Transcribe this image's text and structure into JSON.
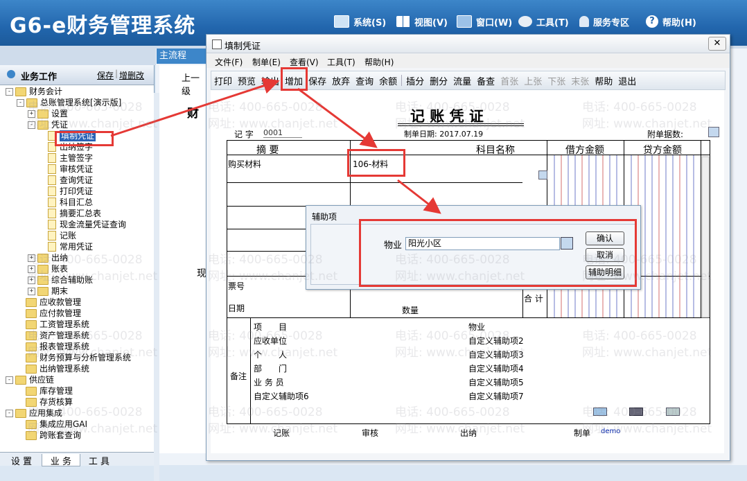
{
  "app": {
    "title": "G6-e财务管理系统"
  },
  "top_menu": [
    {
      "label": "系统(S)",
      "icon": "monitor-icon"
    },
    {
      "label": "视图(V)",
      "icon": "grid-icon"
    },
    {
      "label": "窗口(W)",
      "icon": "window-icon"
    },
    {
      "label": "工具(T)",
      "icon": "gear-icon"
    },
    {
      "label": "服务专区",
      "icon": "user-icon"
    },
    {
      "label": "帮助(H)",
      "icon": "help-icon"
    }
  ],
  "left_panel": {
    "title": "业务工作",
    "save": "保存",
    "add_delete": "增删改",
    "tree": [
      {
        "label": "财务会计",
        "level": 0,
        "type": "folder",
        "exp": "-"
      },
      {
        "label": "总账管理系统[演示版]",
        "level": 1,
        "type": "folder",
        "exp": "-"
      },
      {
        "label": "设置",
        "level": 2,
        "type": "folder",
        "exp": "+"
      },
      {
        "label": "凭证",
        "level": 2,
        "type": "folder",
        "exp": "-"
      },
      {
        "label": "填制凭证",
        "level": 3,
        "type": "doc",
        "selected": true
      },
      {
        "label": "出纳签字",
        "level": 3,
        "type": "doc"
      },
      {
        "label": "主管签字",
        "level": 3,
        "type": "doc"
      },
      {
        "label": "审核凭证",
        "level": 3,
        "type": "doc"
      },
      {
        "label": "查询凭证",
        "level": 3,
        "type": "doc"
      },
      {
        "label": "打印凭证",
        "level": 3,
        "type": "doc"
      },
      {
        "label": "科目汇总",
        "level": 3,
        "type": "doc"
      },
      {
        "label": "摘要汇总表",
        "level": 3,
        "type": "doc"
      },
      {
        "label": "现金流量凭证查询",
        "level": 3,
        "type": "doc"
      },
      {
        "label": "记账",
        "level": 3,
        "type": "doc"
      },
      {
        "label": "常用凭证",
        "level": 3,
        "type": "doc"
      },
      {
        "label": "出纳",
        "level": 2,
        "type": "folder",
        "exp": "+"
      },
      {
        "label": "账表",
        "level": 2,
        "type": "folder",
        "exp": "+"
      },
      {
        "label": "综合辅助账",
        "level": 2,
        "type": "folder",
        "exp": "+"
      },
      {
        "label": "期末",
        "level": 2,
        "type": "folder",
        "exp": "+"
      },
      {
        "label": "应收款管理",
        "level": 1,
        "type": "folder"
      },
      {
        "label": "应付款管理",
        "level": 1,
        "type": "folder"
      },
      {
        "label": "工资管理系统",
        "level": 1,
        "type": "folder"
      },
      {
        "label": "资产管理系统",
        "level": 1,
        "type": "folder"
      },
      {
        "label": "报表管理系统",
        "level": 1,
        "type": "folder"
      },
      {
        "label": "财务预算与分析管理系统",
        "level": 1,
        "type": "folder"
      },
      {
        "label": "出纳管理系统",
        "level": 1,
        "type": "folder"
      },
      {
        "label": "供应链",
        "level": 0,
        "type": "folder",
        "exp": "-"
      },
      {
        "label": "库存管理",
        "level": 1,
        "type": "folder"
      },
      {
        "label": "存货核算",
        "level": 1,
        "type": "folder"
      },
      {
        "label": "应用集成",
        "level": 0,
        "type": "folder",
        "exp": "-"
      },
      {
        "label": "集成应用GAI",
        "level": 1,
        "type": "folder"
      },
      {
        "label": "跨账套查询",
        "level": 1,
        "type": "folder"
      }
    ],
    "bottom_tabs": [
      "设 置",
      "业 务",
      "工 具"
    ]
  },
  "main": {
    "tab": "主流程",
    "back": "上一级",
    "bg_text1": "财",
    "bg_text2": "现"
  },
  "dialog": {
    "title": "填制凭证",
    "menu": [
      "文件(F)",
      "制单(E)",
      "查看(V)",
      "工具(T)",
      "帮助(H)"
    ],
    "toolbar": [
      {
        "label": "打印",
        "enabled": true
      },
      {
        "label": "预览",
        "enabled": true
      },
      {
        "label": "输出",
        "enabled": true
      },
      {
        "label": "增加",
        "enabled": true
      },
      {
        "label": "保存",
        "enabled": true
      },
      {
        "label": "放弃",
        "enabled": true
      },
      {
        "label": "查询",
        "enabled": true
      },
      {
        "label": "余额",
        "enabled": true
      },
      {
        "label": "|",
        "enabled": true
      },
      {
        "label": "插分",
        "enabled": true
      },
      {
        "label": "删分",
        "enabled": true
      },
      {
        "label": "流量",
        "enabled": true
      },
      {
        "label": "备查",
        "enabled": true
      },
      {
        "label": "首张",
        "enabled": false
      },
      {
        "label": "上张",
        "enabled": false
      },
      {
        "label": "下张",
        "enabled": false
      },
      {
        "label": "末张",
        "enabled": false
      },
      {
        "label": "帮助",
        "enabled": true
      },
      {
        "label": "退出",
        "enabled": true
      }
    ]
  },
  "voucher": {
    "title": "记 账 凭 证",
    "type": "记 字",
    "number": "0001",
    "date_label": "制单日期: 2017.07.19",
    "attach_label": "附单据数:",
    "headers": {
      "summary": "摘 要",
      "account": "科目名称",
      "debit": "借方金额",
      "credit": "贷方金额"
    },
    "row1": {
      "summary": "购买材料",
      "account": "106-材料"
    },
    "ticket": "票号",
    "date": "日期",
    "quantity": "数量",
    "total": "合 计",
    "remark": "备注",
    "info_left": [
      "项　　目",
      "应收单位",
      "个　　人",
      "部　　门",
      "业 务 员",
      "自定义辅助项6"
    ],
    "info_right": [
      "物业",
      "自定义辅助项2",
      "自定义辅助项3",
      "自定义辅助项4",
      "自定义辅助项5",
      "自定义辅助项7"
    ],
    "footer": {
      "post": "记账",
      "audit": "审核",
      "cashier": "出纳",
      "maker_label": "制单",
      "maker": "demo"
    }
  },
  "aux_dialog": {
    "title": "辅助项",
    "field_label": "物业",
    "field_value": "阳光小区",
    "ok": "确认",
    "cancel": "取消",
    "detail": "辅助明细"
  },
  "watermark": {
    "phone": "电话: 400-665-0028",
    "site": "网址: www.chanjet.net"
  },
  "colors": {
    "banner": "#2266ad",
    "annotation": "#e53935"
  }
}
